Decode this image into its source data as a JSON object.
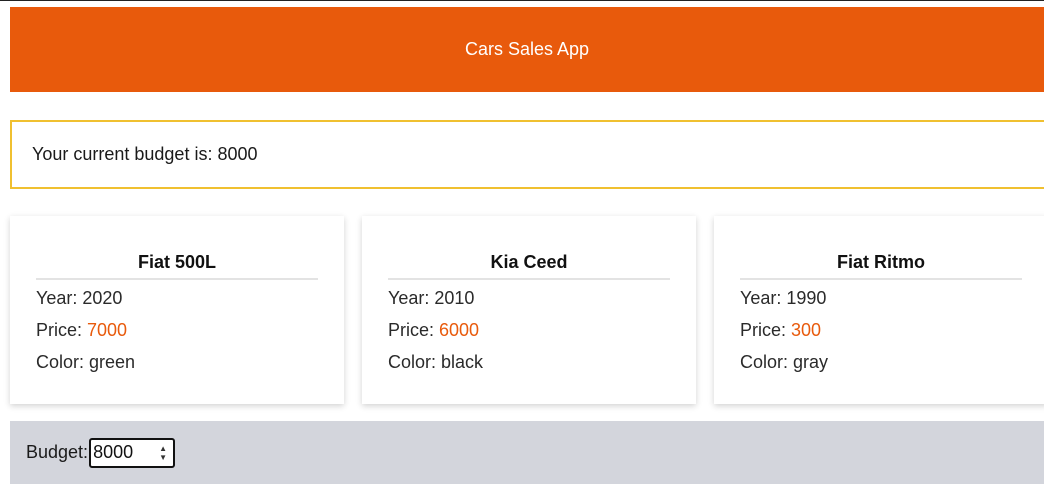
{
  "header": {
    "title": "Cars Sales App"
  },
  "budget_banner": {
    "text": "Your current budget is: 8000"
  },
  "cars": [
    {
      "name": "Fiat 500L",
      "year_label": "Year: ",
      "year": "2020",
      "price_label": "Price: ",
      "price": "7000",
      "color_label": "Color: ",
      "color": "green"
    },
    {
      "name": "Kia Ceed",
      "year_label": "Year: ",
      "year": "2010",
      "price_label": "Price: ",
      "price": "6000",
      "color_label": "Color: ",
      "color": "black"
    },
    {
      "name": "Fiat Ritmo",
      "year_label": "Year: ",
      "year": "1990",
      "price_label": "Price: ",
      "price": "300",
      "color_label": "Color: ",
      "color": "gray"
    }
  ],
  "footer": {
    "budget_label": "Budget:",
    "budget_value": "8000"
  },
  "colors": {
    "accent": "#e85a0c",
    "banner_border": "#f0c030",
    "footer_bg": "#d3d5dc"
  }
}
